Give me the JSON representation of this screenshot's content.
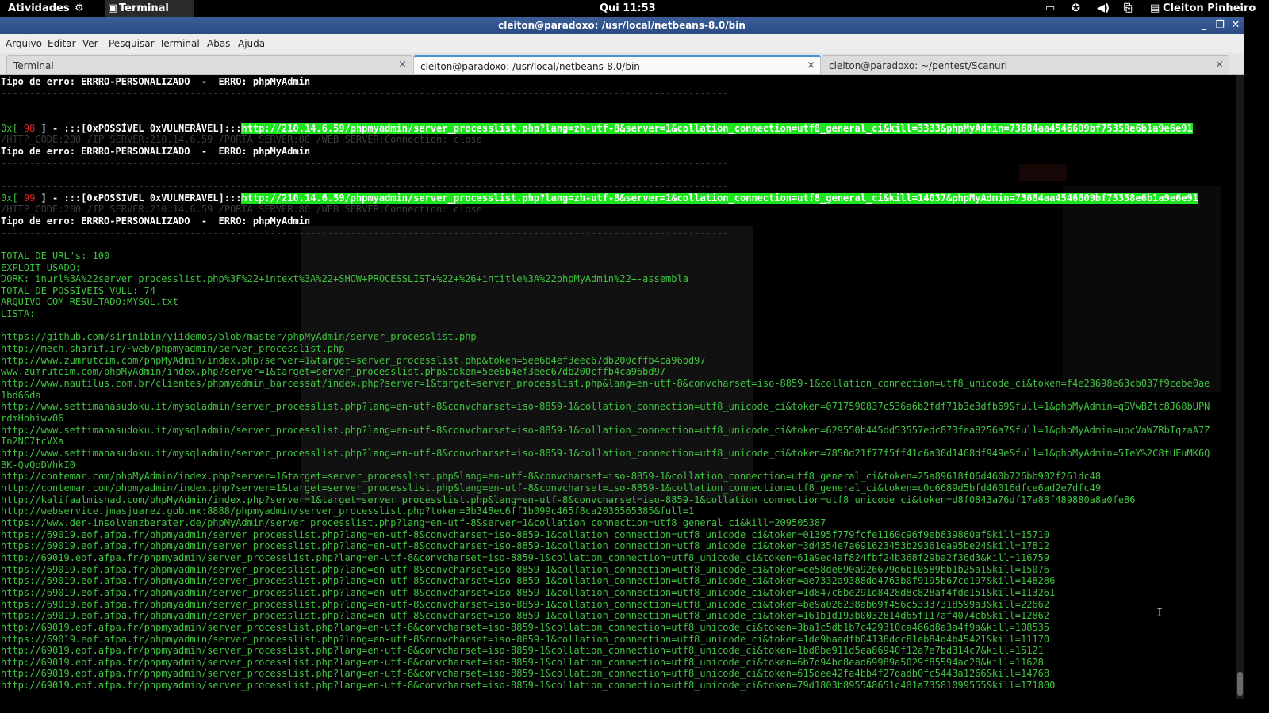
{
  "topbar": {
    "activities": "Atividades",
    "app_name": "Terminal",
    "clock": "Qui 11:53",
    "user": "Cleiton Pinheiro"
  },
  "window": {
    "title": "cleiton@paradoxo: /usr/local/netbeans-8.0/bin"
  },
  "menu": [
    "Arquivo",
    "Editar",
    "Ver",
    "Pesquisar",
    "Terminal",
    "Abas",
    "Ajuda"
  ],
  "tabs": [
    {
      "label": "Terminal"
    },
    {
      "label": "cleiton@paradoxo: /usr/local/netbeans-8.0/bin"
    },
    {
      "label": "cleiton@paradoxo: ~/pentest/Scanurl"
    }
  ],
  "terminal": {
    "lines": [
      {
        "t": "Tipo de erro: ERRRO-PERSONALIZADO  -  ERRO: phpMyAdmin",
        "s": "w"
      },
      {
        "t": "-------------------------------------------------------------------------------------------------------------------------------",
        "s": "dg"
      },
      {
        "t": "-------------------------------------------------------------------------------------------------------------------------------",
        "s": "dg"
      },
      {
        "t": "",
        "s": "g"
      },
      {
        "t": "0x[",
        "s": "g",
        "num": " 98 ",
        "mid": "] - :::[0xPOSSÍVEL 0xVULNERÁVEL]:::",
        "url": "http://210.14.6.59/phpmyadmin/server_processlist.php?lang=zh-utf-8&server=1&collation_connection=utf8_general_ci&kill=3333&phpMyAdmin=73684aa4546609bf75358e6b1a9e6e91"
      },
      {
        "t": "/HTTP_CODE:200 /IP SERVER:210.14.6.59 /PORTA SERVER:80 /WEB SERVER:Connection: close",
        "s": "dg"
      },
      {
        "t": "Tipo de erro: ERRRO-PERSONALIZADO  -  ERRO: phpMyAdmin",
        "s": "w"
      },
      {
        "t": "-------------------------------------------------------------------------------------------------------------------------------",
        "s": "dg"
      },
      {
        "t": "",
        "s": "g"
      },
      {
        "t": "-------------------------------------------------------------------------------------------------------------------------------",
        "s": "dg"
      },
      {
        "t": "0x[",
        "s": "g",
        "num": " 99 ",
        "mid": "] - :::[0xPOSSÍVEL 0xVULNERÁVEL]:::",
        "url": "http://210.14.6.59/phpmyadmin/server_processlist.php?lang=zh-utf-8&server=1&collation_connection=utf8_general_ci&kill=14037&phpMyAdmin=73684aa4546609bf75358e6b1a9e6e91"
      },
      {
        "t": "/HTTP_CODE:200 /IP SERVER:210.14.6.59 /PORTA SERVER:80 /WEB SERVER:Connection: close",
        "s": "dg"
      },
      {
        "t": "Tipo de erro: ERRRO-PERSONALIZADO  -  ERRO: phpMyAdmin",
        "s": "w"
      },
      {
        "t": "-------------------------------------------------------------------------------------------------------------------------------",
        "s": "dg"
      },
      {
        "t": "",
        "s": "g"
      },
      {
        "t": "TOTAL DE URL's: 100",
        "s": "g"
      },
      {
        "t": "EXPLOIT USADO:",
        "s": "g"
      },
      {
        "t": "DORK: inurl%3A%22server_processlist.php%3F%22+intext%3A%22+SHOW+PROCESSLIST+%22+%26+intitle%3A%22phpMyAdmin%22+-assembla",
        "s": "g"
      },
      {
        "t": "TOTAL DE POSSÍVEIS VULL: 74",
        "s": "g"
      },
      {
        "t": "ARQUIVO COM RESULTADO:MYSQL.txt",
        "s": "g"
      },
      {
        "t": "LISTA:",
        "s": "g"
      },
      {
        "t": "",
        "s": "g"
      },
      {
        "t": "https://github.com/sirinibin/yiidemos/blob/master/phpMyAdmin/server_processlist.php",
        "s": "g"
      },
      {
        "t": "http://mech.sharif.ir/~web/phpmyadmin/server_processlist.php",
        "s": "g"
      },
      {
        "t": "http://www.zumrutcim.com/phpMyAdmin/index.php?server=1&target=server_processlist.php&token=5ee6b4ef3eec67db200cffb4ca96bd97",
        "s": "g"
      },
      {
        "t": "www.zumrutcim.com/phpMyAdmin/index.php?server=1&target=server_processlist.php&token=5ee6b4ef3eec67db200cffb4ca96bd97",
        "s": "g"
      },
      {
        "t": "http://www.nautilus.com.br/clientes/phpmyadmin_barcessat/index.php?server=1&target=server_processlist.php&lang=en-utf-8&convcharset=iso-8859-1&collation_connection=utf8_unicode_ci&token=f4e23698e63cb037f9cebe0ae",
        "s": "g"
      },
      {
        "t": "1bd66da",
        "s": "g"
      },
      {
        "t": "http://www.settimanasudoku.it/mysqladmin/server_processlist.php?lang=en-utf-8&convcharset=iso-8859-1&collation_connection=utf8_unicode_ci&token=0717590837c536a6b2fdf71b3e3dfb69&full=1&phpMyAdmin=qSVwBZtc8J68bUPN",
        "s": "g"
      },
      {
        "t": "rdmHohiwv06",
        "s": "g"
      },
      {
        "t": "http://www.settimanasudoku.it/mysqladmin/server_processlist.php?lang=en-utf-8&convcharset=iso-8859-1&collation_connection=utf8_unicode_ci&token=629550b445dd53557edc873fea8256a7&full=1&phpMyAdmin=upcVaWZRbIqzaA7Z",
        "s": "g"
      },
      {
        "t": "In2NC7tcVXa",
        "s": "g"
      },
      {
        "t": "http://www.settimanasudoku.it/mysqladmin/server_processlist.php?lang=en-utf-8&convcharset=iso-8859-1&collation_connection=utf8_unicode_ci&token=7850d21f77f5ff41c6a30d1468df949e&full=1&phpMyAdmin=5IeY%2C8tUFuMK6Q",
        "s": "g"
      },
      {
        "t": "BK-QvQoDVhkI0",
        "s": "g"
      },
      {
        "t": "http://contemar.com/phpMyAdmin/index.php?server=1&target=server_processlist.php&lang=en-utf-8&convcharset=iso-8859-1&collation_connection=utf8_general_ci&token=25a89618f06d460b726bb902f261dc48",
        "s": "g"
      },
      {
        "t": "http://contemar.com/phpmyadmin/index.php?server=1&target=server_processlist.php&lang=en-utf-8&convcharset=iso-8859-1&collation_connection=utf8_general_ci&token=c0c6689d5bfd46016dfce6ad2e7dfc49",
        "s": "g"
      },
      {
        "t": "http://kalifaalmisnad.com/phpMyAdmin/index.php?server=1&target=server_processlist.php&lang=en-utf-8&convcharset=iso-8859-1&collation_connection=utf8_unicode_ci&token=d8f0843a76df17a88f489880a8a0fe86",
        "s": "g"
      },
      {
        "t": "http://webservice.jmasjuarez.gob.mx:8888/phpmyadmin/server_processlist.php?token=3b348ec6ff1b099c465f8ca2036565385&full=1",
        "s": "g"
      },
      {
        "t": "https://www.der-insolvenzberater.de/phpMyAdmin/server_processlist.php?lang=en-utf-8&server=1&collation_connection=utf8_general_ci&kill=209505387",
        "s": "g"
      },
      {
        "t": "https://69019.eof.afpa.fr/phpmyadmin/server_processlist.php?lang=en-utf-8&convcharset=iso-8859-1&collation_connection=utf8_unicode_ci&token=01395f779fcfe1160c96f9eb839860af&kill=15710",
        "s": "g"
      },
      {
        "t": "https://69019.eof.afpa.fr/phpmyadmin/server_processlist.php?lang=en-utf-8&convcharset=iso-8859-1&collation_connection=utf8_unicode_ci&token=3d4354e7a691623453b29361ea95be24&kill=17812",
        "s": "g"
      },
      {
        "t": "http://69019.eof.afpa.fr/phpmyadmin/server_processlist.php?lang=en-utf-8&convcharset=iso-8859-1&collation_connection=utf8_unicode_ci&token=61a9ec4af824fbf24b368f29ba2f36d3&kill=116759",
        "s": "g"
      },
      {
        "t": "https://69019.eof.afpa.fr/phpmyadmin/server_processlist.php?lang=en-utf-8&convcharset=iso-8859-1&collation_connection=utf8_unicode_ci&token=ce58de690a926679d6b10589bb1b25a1&kill=15076",
        "s": "g"
      },
      {
        "t": "https://69019.eof.afpa.fr/phpmyadmin/server_processlist.php?lang=en-utf-8&convcharset=iso-8859-1&collation_connection=utf8_unicode_ci&token=ae7332a9388dd4763b0f9195b67ce197&kill=148286",
        "s": "g"
      },
      {
        "t": "https://69019.eof.afpa.fr/phpmyadmin/server_processlist.php?lang=en-utf-8&convcharset=iso-8859-1&collation_connection=utf8_unicode_ci&token=1d847c6be291d8428d8c828af4fde151&kill=113261",
        "s": "g"
      },
      {
        "t": "https://69019.eof.afpa.fr/phpmyadmin/server_processlist.php?lang=en-utf-8&convcharset=iso-8859-1&collation_connection=utf8_unicode_ci&token=be9a026238ab69f456c53337318599a3&kill=22662",
        "s": "g"
      },
      {
        "t": "https://69019.eof.afpa.fr/phpmyadmin/server_processlist.php?lang=en-utf-8&convcharset=iso-8859-1&collation_connection=utf8_unicode_ci&token=161b1d193b0032814d65f117af4074cb&kill=12862",
        "s": "g"
      },
      {
        "t": "http://69019.eof.afpa.fr/phpmyadmin/server_processlist.php?lang=en-utf-8&convcharset=iso-8859-1&collation_connection=utf8_unicode_ci&token=3ba1c5db1b7c429310ca466d8a3a4f9a&kill=108535",
        "s": "g"
      },
      {
        "t": "https://69019.eof.afpa.fr/phpmyadmin/server_processlist.php?lang=en-utf-8&convcharset=iso-8859-1&collation_connection=utf8_unicode_ci&token=1de9baadfb04138dcc81eb84d4b45421&kill=11170",
        "s": "g"
      },
      {
        "t": "http://69019.eof.afpa.fr/phpmyadmin/server_processlist.php?lang=en-utf-8&convcharset=iso-8859-1&collation_connection=utf8_unicode_ci&token=1bd8be911d5ea86940f12a7e7bd314c7&kill=15121",
        "s": "g"
      },
      {
        "t": "http://69019.eof.afpa.fr/phpmyadmin/server_processlist.php?lang=en-utf-8&convcharset=iso-8859-1&collation_connection=utf8_unicode_ci&token=6b7d94bc8ead69989a5029f85594ac28&kill=11628",
        "s": "g"
      },
      {
        "t": "http://69019.eof.afpa.fr/phpmyadmin/server_processlist.php?lang=en-utf-8&convcharset=iso-8859-1&collation_connection=utf8_unicode_ci&token=615dee42fa4bb4f27dadb0fc5443a1266&kill=14768",
        "s": "g"
      },
      {
        "t": "http://69019.eof.afpa.fr/phpmyadmin/server_processlist.php?lang=en-utf-8&convcharset=iso-8859-1&collation_connection=utf8_unicode_ci&token=79d1803b895548651c481a73581099555&kill=171800",
        "s": "g"
      }
    ]
  },
  "colors": {
    "terminal_bg": "#000000",
    "text_green": "#3fc43f",
    "highlight_green": "#1ee61e",
    "title_blue": "#2a4a82"
  }
}
